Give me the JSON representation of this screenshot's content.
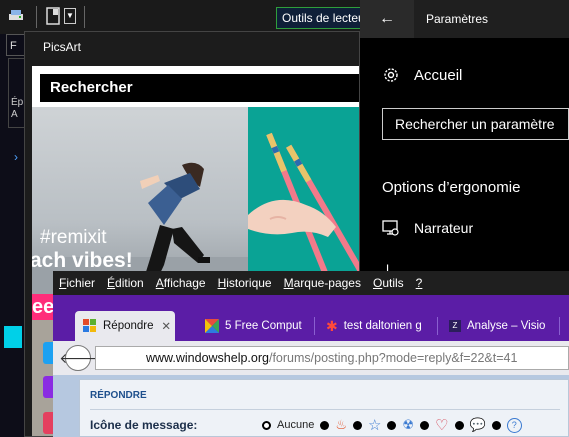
{
  "explorer": {
    "tools_tab": "Outils de lecteur",
    "tab_label": "F",
    "pane_lines": [
      "Ép",
      "A"
    ]
  },
  "picsart": {
    "window_title": "PicsArt",
    "search_label": "Rechercher",
    "hashtag": "#remixit",
    "slogan": "ach vibes!"
  },
  "settings": {
    "title": "Paramètres",
    "home": "Accueil",
    "search_placeholder": "Rechercher un paramètre",
    "section_heading": "Options d’ergonomie",
    "narrator": "Narrateur",
    "next_item": "L"
  },
  "firefox": {
    "menu": [
      "Fichier",
      "Édition",
      "Affichage",
      "Historique",
      "Marque-pages",
      "Outils",
      "?"
    ],
    "menu_mnemonics": [
      "F",
      "É",
      "A",
      "H",
      "M",
      "O",
      "?"
    ],
    "tabs": [
      {
        "label": "Répondre",
        "active": true
      },
      {
        "label": "5 Free Comput",
        "active": false
      },
      {
        "label": "test daltonien g",
        "active": false
      },
      {
        "label": "Analyse – Visio",
        "active": false
      }
    ],
    "url_host": "www.windowshelp.org",
    "url_path": "/forums/posting.php?mode=reply&f=22&t=41",
    "section_title": "RÉPONDRE",
    "message_icon_label": "Icône de message:",
    "no_icon_label": "Aucune"
  },
  "colors": {
    "firefox_purple": "#5b1da6",
    "tools_tab_border": "#2f9e3b",
    "teal_photo": "#0aa395",
    "link_blue": "#1d4f8c"
  }
}
